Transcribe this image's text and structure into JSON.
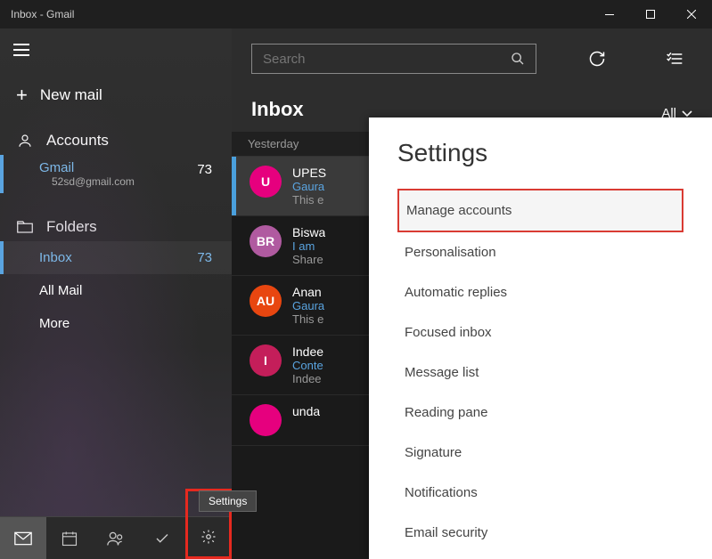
{
  "window": {
    "title": "Inbox - Gmail"
  },
  "sidebar": {
    "new_mail": "New mail",
    "accounts_label": "Accounts",
    "account": {
      "name": "Gmail",
      "email": "52sd@gmail.com",
      "count": "73"
    },
    "folders_label": "Folders",
    "folders": [
      {
        "label": "Inbox",
        "count": "73",
        "active": true
      },
      {
        "label": "All Mail",
        "count": "",
        "active": false
      },
      {
        "label": "More",
        "count": "",
        "active": false
      }
    ]
  },
  "bottom": {
    "tooltip": "Settings"
  },
  "search": {
    "placeholder": "Search"
  },
  "inbox": {
    "title": "Inbox",
    "filter": "All"
  },
  "date_group": "Yesterday",
  "messages": [
    {
      "initials": "U",
      "color": "#e6007e",
      "from": "UPES",
      "subject": "Gaura",
      "preview": "This e"
    },
    {
      "initials": "BR",
      "color": "#b05aa0",
      "from": "Biswa",
      "subject": "I am",
      "preview": "Share"
    },
    {
      "initials": "AU",
      "color": "#e84610",
      "from": "Anan",
      "subject": "Gaura",
      "preview": "This e"
    },
    {
      "initials": "I",
      "color": "#c41e5a",
      "from": "Indee",
      "subject": "Conte",
      "preview": "Indee"
    },
    {
      "initials": "",
      "color": "#e6007e",
      "from": "unda",
      "subject": "",
      "preview": ""
    }
  ],
  "settings": {
    "title": "Settings",
    "items": [
      "Manage accounts",
      "Personalisation",
      "Automatic replies",
      "Focused inbox",
      "Message list",
      "Reading pane",
      "Signature",
      "Notifications",
      "Email security"
    ],
    "highlighted_index": 0
  }
}
